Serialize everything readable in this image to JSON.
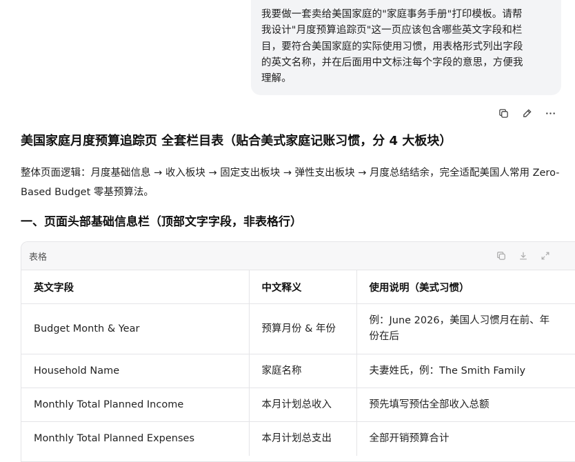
{
  "user_message": {
    "lines": [
      "我要做一套卖给美国家庭的\"家庭事务手册\"打印模板。请帮",
      "我设计\"月度预算追踪页\"这一页应该包含哪些英文字段和栏",
      "目，要符合美国家庭的实际使用习惯，用表格形式列出字段",
      "的英文名称，并在后面用中文标注每个字段的意思，方便我",
      "理解。"
    ]
  },
  "message_actions": [
    "copy-icon",
    "edit-icon",
    "more-icon"
  ],
  "response": {
    "heading": "美国家庭月度预算追踪页 全套栏目表（贴合美式家庭记账习惯，分 4 大板块）",
    "intro": "整体页面逻辑：月度基础信息 → 收入板块 → 固定支出板块 → 弹性支出板块 → 月度总结结余，完全适配美国人常用 Zero-Based Budget 零基预算法。",
    "section1_heading": "一、页面头部基础信息栏（顶部文字字段，非表格行）"
  },
  "table": {
    "label": "表格",
    "tools": [
      "copy-icon",
      "download-icon",
      "expand-icon"
    ],
    "headers": [
      "英文字段",
      "中文释义",
      "使用说明（美式习惯）"
    ],
    "rows": [
      [
        "Budget Month & Year",
        "预算月份 & 年份",
        "例：June 2026，美国人习惯月在前、年",
        "份在后"
      ],
      [
        "Household Name",
        "家庭名称",
        "夫妻姓氏，例：The Smith Family"
      ],
      [
        "Monthly Total Planned Income",
        "本月计划总收入",
        "预先填写预估全部收入总额"
      ],
      [
        "Monthly Total Planned Expenses",
        "本月计划总支出",
        "全部开销预算合计"
      ]
    ]
  }
}
